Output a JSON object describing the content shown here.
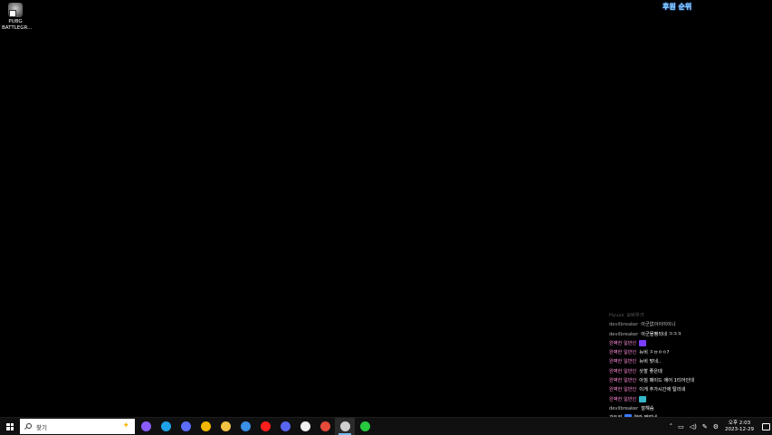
{
  "desktop": {
    "icons": [
      {
        "label": "PUBG\nBATTLEGR...",
        "icon": "pubg-icon"
      }
    ],
    "overlay_title": "후원 순위"
  },
  "chat": [
    {
      "nick": "Hyuxx",
      "msg": "오비우기",
      "nick_color": "#555555",
      "msg_color": "#6a6a6a"
    },
    {
      "nick": "devilbreaker",
      "msg": "아군없이이이이니",
      "nick_color": "#9a9a9a",
      "msg_color": "#cfcfcf"
    },
    {
      "nick": "devilbreaker",
      "msg": "아군몰빵되네 ㅋㅋㅋ",
      "nick_color": "#b0b0b0",
      "msg_color": "#ffffff"
    },
    {
      "nick": "완벽한 일반인",
      "msg": "",
      "nick_color": "#ff8ad8",
      "msg_color": "#ffffff",
      "emote": "#7a3cff"
    },
    {
      "nick": "완벽한 일반인",
      "msg": "뉴비 ㅈㅂㅇㅇ?",
      "nick_color": "#ff8ad8",
      "msg_color": "#ffffff"
    },
    {
      "nick": "완벽한 일반인",
      "msg": "뉴비 맞네..",
      "nick_color": "#ff8ad8",
      "msg_color": "#ffffff"
    },
    {
      "nick": "완벽한 일반인",
      "msg": "삿할 좋은데",
      "nick_color": "#ff8ad8",
      "msg_color": "#ffffff"
    },
    {
      "nick": "완벽한 일반인",
      "msg": "아침 페이드 에어 1티어인데",
      "nick_color": "#ff8ad8",
      "msg_color": "#ffffff"
    },
    {
      "nick": "완벽한 일반인",
      "msg": "이게 추가시간에 탈리네",
      "nick_color": "#ff8ad8",
      "msg_color": "#ffffff"
    },
    {
      "nick": "완벽한 일반인",
      "msg": "",
      "nick_color": "#ff8ad8",
      "msg_color": "#ffffff",
      "emote": "#35b6c9"
    },
    {
      "nick": "devilbreaker",
      "msg": "잘해슴",
      "nick_color": "#c0c0c0",
      "msg_color": "#ffffff"
    },
    {
      "nick": "강두리",
      "msg": "연락 됐었네",
      "nick_color": "#ffffff",
      "msg_color": "#ffffff",
      "emote": "#3c7bff"
    },
    {
      "nick": "강두리",
      "msg": "다잡았는 드랍",
      "nick_color": "#ffffff",
      "msg_color": "#ffffff",
      "emote": "#7a5cff"
    }
  ],
  "taskbar": {
    "search_placeholder": "찾기",
    "apps": [
      {
        "name": "copilot-app-icon",
        "color": "#8a5cff"
      },
      {
        "name": "edge-browser-icon",
        "color": "#1fa3e6"
      },
      {
        "name": "copilot-app-icon-2",
        "color": "#5b6cff"
      },
      {
        "name": "chrome-icon",
        "color": "#f2b705"
      },
      {
        "name": "file-explorer-icon",
        "color": "#f3c243"
      },
      {
        "name": "mail-icon",
        "color": "#3a8fe6"
      },
      {
        "name": "youtube-icon",
        "color": "#ff1e1e"
      },
      {
        "name": "discord-icon",
        "color": "#5865f2"
      },
      {
        "name": "overwatch-icon",
        "color": "#f0f0f0"
      },
      {
        "name": "chrome-icon-2",
        "color": "#e64a3b"
      },
      {
        "name": "obs-icon",
        "color": "#cfcfcf",
        "active": true
      },
      {
        "name": "naver-whale-icon",
        "color": "#27c93f"
      }
    ],
    "tray": {
      "clock_time": "오후 2:03",
      "clock_date": "2023-12-29"
    }
  }
}
